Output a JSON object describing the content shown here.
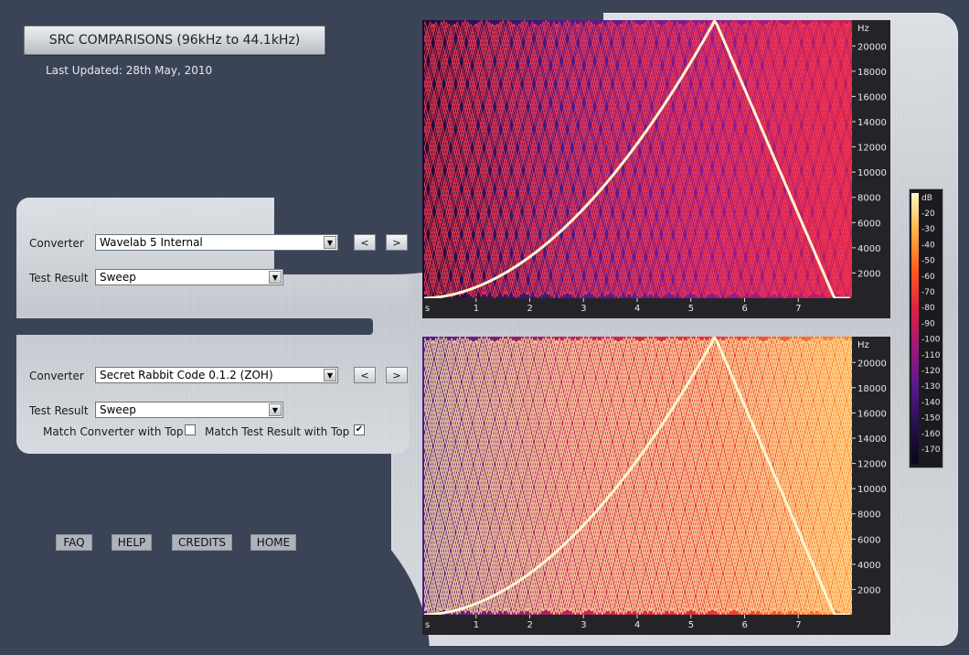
{
  "header": {
    "title": "SRC COMPARISONS (96kHz to 44.1kHz)",
    "last_updated": "Last Updated: 28th May, 2010"
  },
  "top_panel": {
    "converter_label": "Converter",
    "converter_value": "Wavelab 5 Internal",
    "prev_label": "<",
    "next_label": ">",
    "test_label": "Test Result",
    "test_value": "Sweep"
  },
  "bottom_panel": {
    "converter_label": "Converter",
    "converter_value": "Secret Rabbit Code 0.1.2 (ZOH)",
    "prev_label": "<",
    "next_label": ">",
    "test_label": "Test Result",
    "test_value": "Sweep",
    "match_converter_label": "Match Converter with Top",
    "match_converter_checked": false,
    "match_test_label": "Match Test Result with Top",
    "match_test_checked": true
  },
  "footer_links": [
    "FAQ",
    "HELP",
    "CREDITS",
    "HOME"
  ],
  "chart_data": [
    {
      "type": "heatmap",
      "name": "top-spectrogram",
      "y_unit": "Hz",
      "x_unit": "s",
      "y_ticks": [
        20000,
        18000,
        16000,
        14000,
        12000,
        10000,
        8000,
        6000,
        4000,
        2000
      ],
      "x_ticks": [
        1,
        2,
        3,
        4,
        5,
        6,
        7
      ],
      "xlim": [
        0,
        8
      ],
      "ylim": [
        0,
        22050
      ],
      "palette": [
        "#1a0b3a",
        "#4a1a8a",
        "#8a1a8f",
        "#c0205f",
        "#e8303a",
        "#ff8c2a",
        "#fff2b0"
      ],
      "sweep_peak_time": 5.45,
      "sweep_peak_freq": 22050
    },
    {
      "type": "heatmap",
      "name": "bottom-spectrogram",
      "y_unit": "Hz",
      "x_unit": "s",
      "y_ticks": [
        20000,
        18000,
        16000,
        14000,
        12000,
        10000,
        8000,
        6000,
        4000,
        2000
      ],
      "x_ticks": [
        1,
        2,
        3,
        4,
        5,
        6,
        7
      ],
      "xlim": [
        0,
        8
      ],
      "ylim": [
        0,
        22050
      ],
      "palette": [
        "#4a1a8a",
        "#c0205f",
        "#e8303a",
        "#ff8c2a",
        "#ffc07a",
        "#fff2b0"
      ]
    }
  ],
  "legend": {
    "unit": "dB",
    "ticks": [
      -20,
      -30,
      -40,
      -50,
      -60,
      -70,
      -80,
      -90,
      -100,
      -110,
      -120,
      -130,
      -140,
      -150,
      -160,
      -170
    ]
  }
}
